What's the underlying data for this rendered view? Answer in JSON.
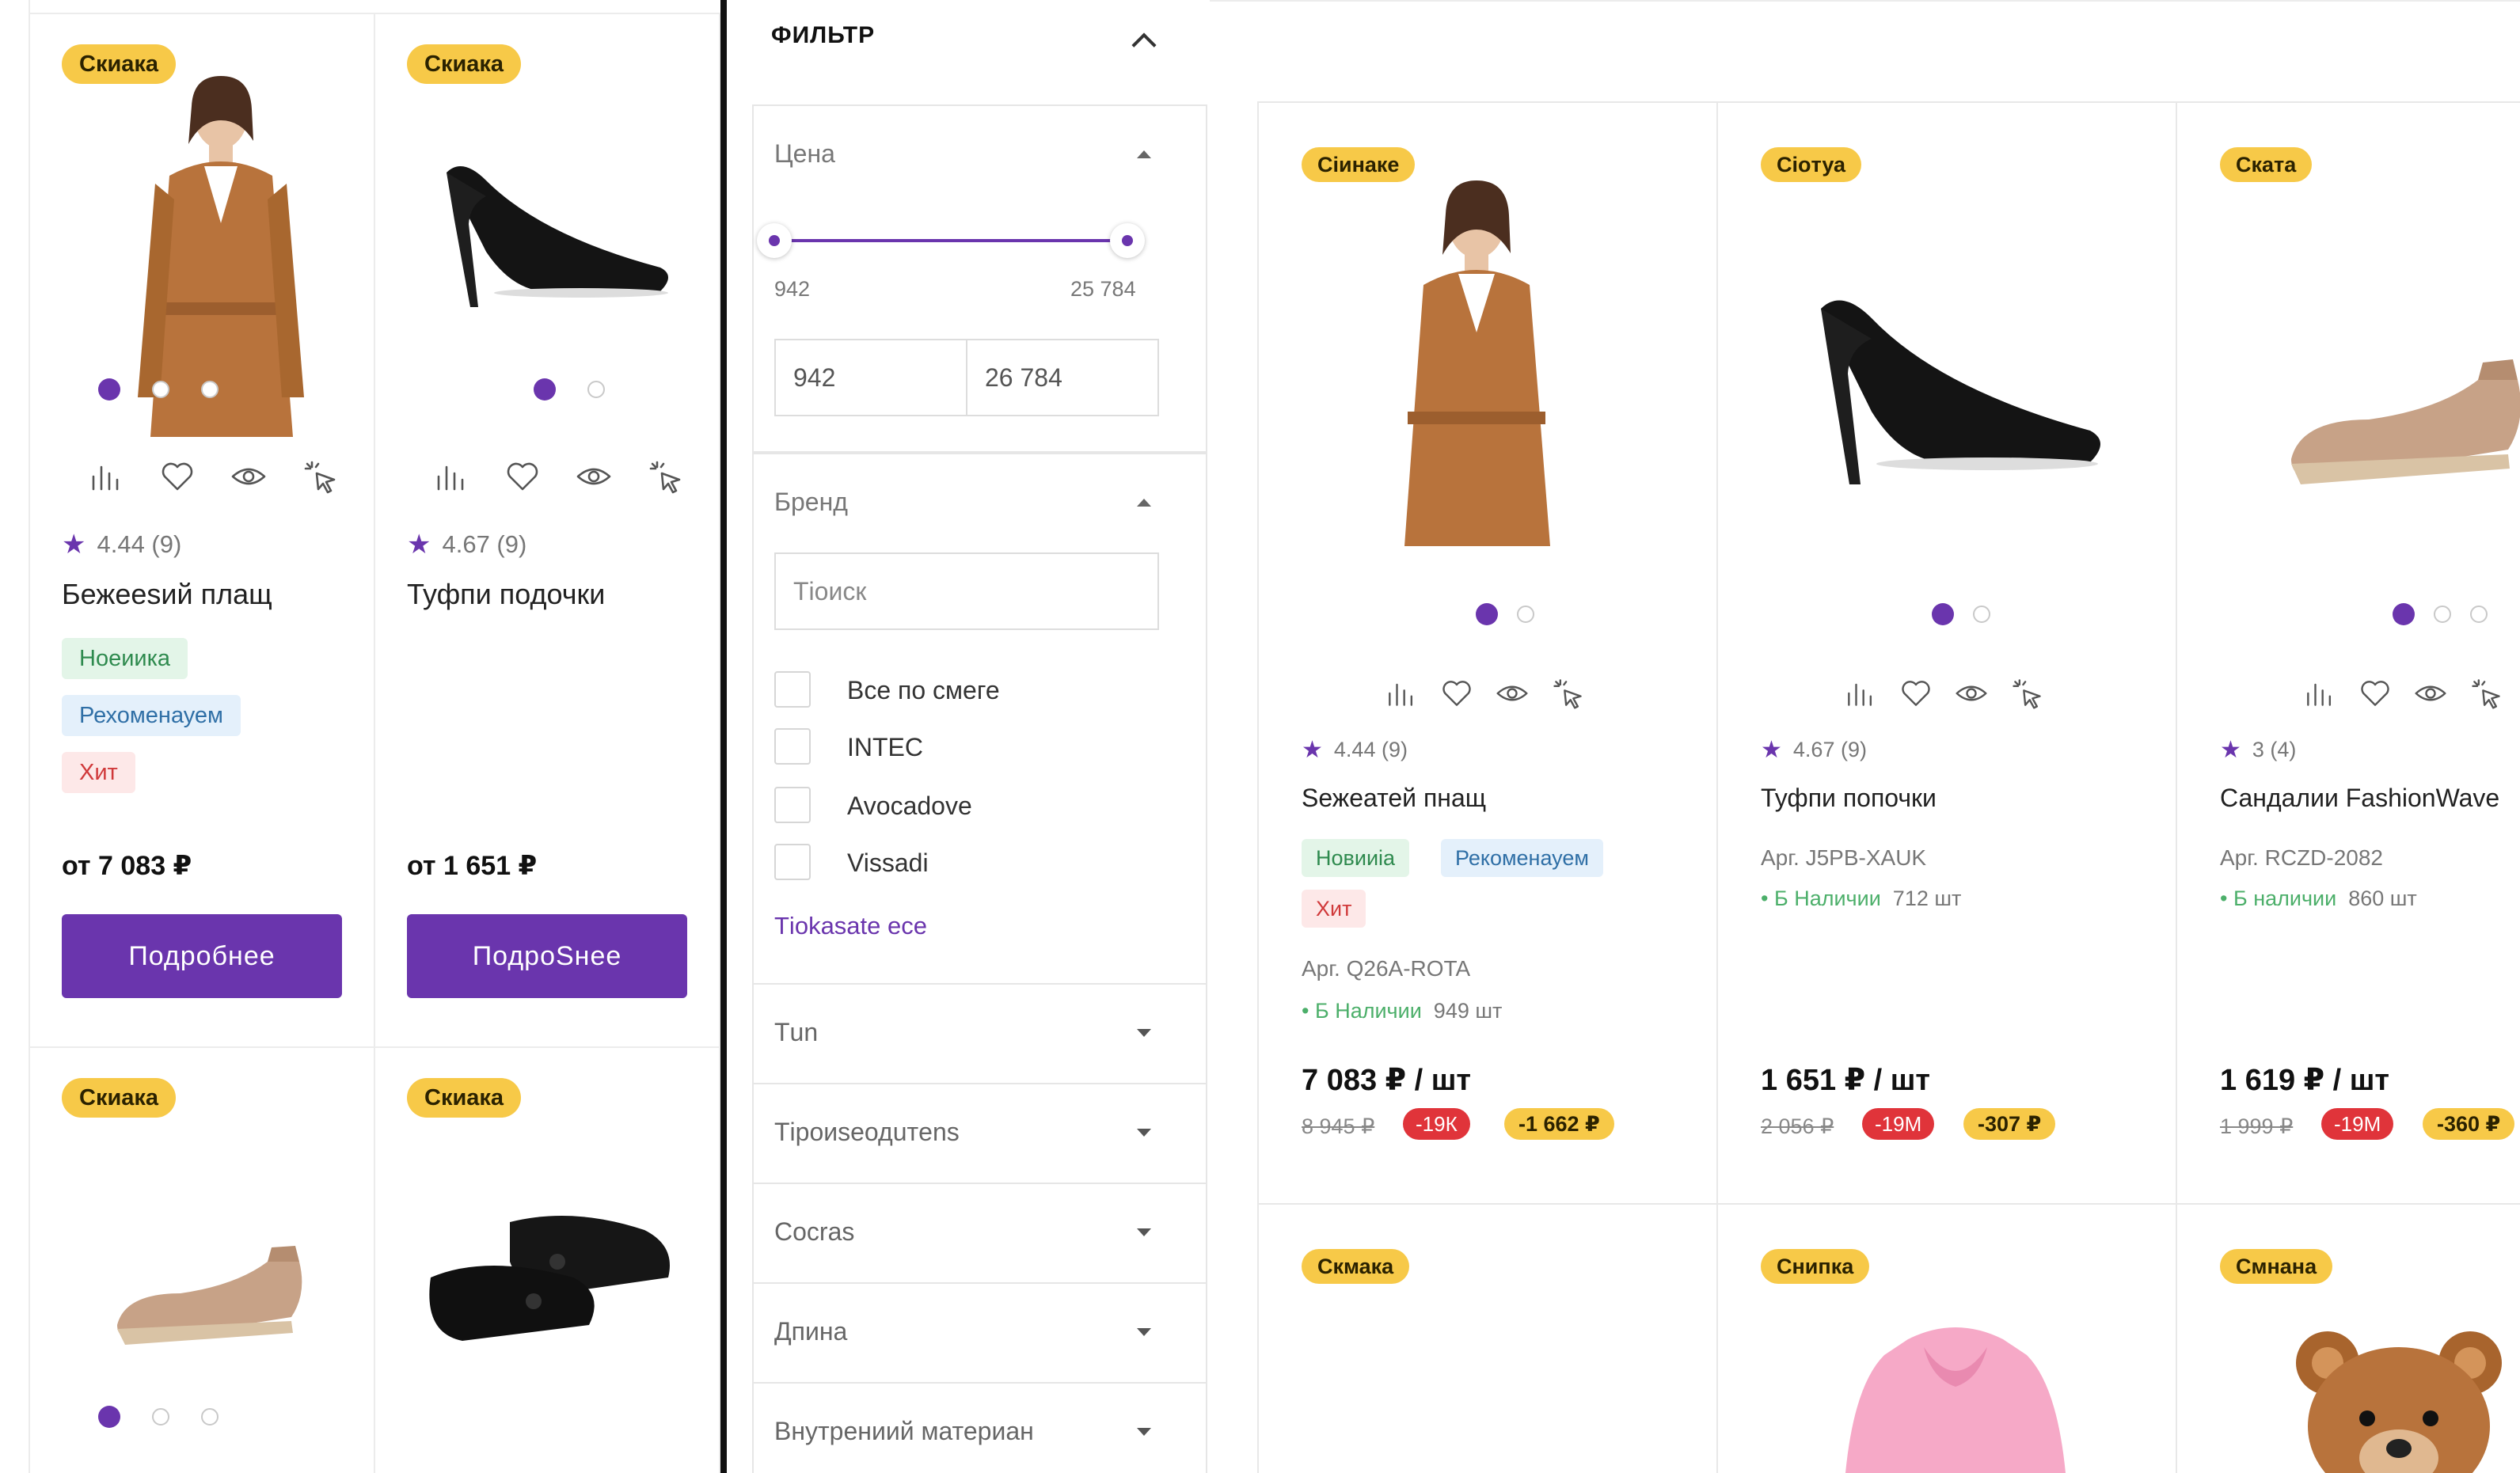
{
  "colors": {
    "accent": "#6a35ad",
    "badge": "#f7c948",
    "discount_red": "#e0343a"
  },
  "left_cards": [
    {
      "badge": "Скиака",
      "rating": "4.44 (9)",
      "name": "Бежееѕий плащ",
      "tags": [
        "Ноеиика",
        "Рехоменауем",
        "Хит"
      ],
      "price": "от 7 083 ₽",
      "button": "Подробнее",
      "image": "coat-photo"
    },
    {
      "badge": "Скиака",
      "rating": "4.67 (9)",
      "name": "Туфпи подочки",
      "tags": [],
      "price": "от 1 651 ₽",
      "button": "ПодроЅнее",
      "image": "heel-shoe-photo"
    },
    {
      "badge": "Скиака",
      "image": "sandal-photo"
    },
    {
      "badge": "Скиака",
      "image": "loafers-photo"
    }
  ],
  "filter": {
    "title": "ФИЛЬТР",
    "price": {
      "title": "Цена",
      "min": "942",
      "max": "25 784",
      "from_value": "942",
      "to_value": "26 784"
    },
    "brand": {
      "title": "Бренд",
      "search_placeholder": "Тioиск",
      "options": [
        "Все по смеге",
        "INTEC",
        "Avocadove",
        "Vissadi"
      ],
      "show_all": "Тiokasate ece"
    },
    "sections": [
      "Тun",
      "Тipоиseодuтens",
      "Cocras",
      "Дпина",
      "Внутрениий материан"
    ]
  },
  "right_cards": [
    {
      "badge": "Сiинаке",
      "rating": "4.44 (9)",
      "name": "Ѕежеатей пнащ",
      "tags": [
        "Новииiа",
        "Рекоменауем",
        "Хит"
      ],
      "article": "Арг. Q26A-ROTA",
      "stock_label": "Б Наличии",
      "stock_count": "949 шт",
      "price": "7 083 ₽ / шт",
      "old_price": "8 945 ₽",
      "discount_pct": "-19К",
      "discount_sum": "-1 662 ₽",
      "image": "coat-photo"
    },
    {
      "badge": "Сioтуа",
      "rating": "4.67 (9)",
      "name": "Туфпи попочки",
      "tags": [],
      "article": "Арг. J5PB-XAUK",
      "stock_label": "Б Наличии",
      "stock_count": "712 шт",
      "price": "1 651 ₽ / шт",
      "old_price": "2 056 ₽",
      "discount_pct": "-19М",
      "discount_sum": "-307 ₽",
      "image": "heel-shoe-photo"
    },
    {
      "badge": "Ската",
      "rating": "3 (4)",
      "name": "Сандалии FashionWave",
      "tags": [],
      "article": "Арг. RCZD-2082",
      "stock_label": "Б наличии",
      "stock_count": "860 шт",
      "price": "1 619 ₽ / шт",
      "old_price": "1 999 ₽",
      "discount_pct": "-19М",
      "discount_sum": "-360 ₽",
      "image": "sandal-photo"
    },
    {
      "badge": "Скмака",
      "image": "empty"
    },
    {
      "badge": "Снипка",
      "image": "pink-hoodie-photo"
    },
    {
      "badge": "Смнана",
      "image": "teddy-bear-photo"
    }
  ]
}
